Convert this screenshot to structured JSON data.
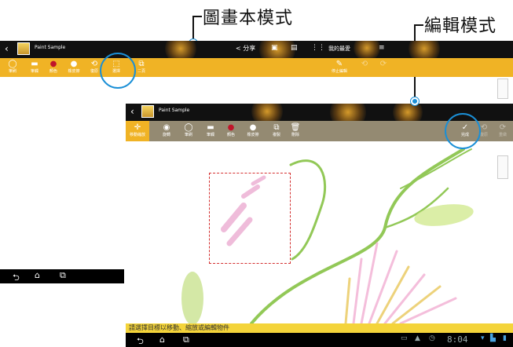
{
  "callouts": {
    "book_mode": "圖畫本模式",
    "edit_mode": "編輯模式"
  },
  "app": {
    "title": "Paint Sample"
  },
  "book_actionbar": {
    "share_label": "分享",
    "favorite_label": "我的最愛",
    "menu_icon": "overflow-menu-icon"
  },
  "book_toolbar": {
    "items": [
      {
        "label": "筆刷",
        "icon": "brush-icon"
      },
      {
        "label": "筆觸",
        "icon": "stroke-icon"
      },
      {
        "label": "顏色",
        "icon": "color-icon"
      },
      {
        "label": "橡皮擦",
        "icon": "eraser-icon"
      },
      {
        "label": "復原",
        "icon": "undo-icon"
      },
      {
        "label": "選擇",
        "icon": "select-icon"
      },
      {
        "label": "二頁",
        "icon": "two-page-icon"
      }
    ],
    "stop_edit": "停止編輯"
  },
  "edit_toolbar": {
    "items": [
      {
        "label": "移動縮放",
        "icon": "move-scale-icon"
      },
      {
        "label": "旋轉",
        "icon": "rotate-icon"
      },
      {
        "label": "筆刷",
        "icon": "brush-icon"
      },
      {
        "label": "筆觸",
        "icon": "stroke-icon"
      },
      {
        "label": "顏色",
        "icon": "color-icon"
      },
      {
        "label": "橡皮擦",
        "icon": "eraser-icon"
      },
      {
        "label": "複製",
        "icon": "copy-icon"
      },
      {
        "label": "刪除",
        "icon": "delete-icon"
      }
    ],
    "done": "完成",
    "undo": "復原",
    "redo": "重做"
  },
  "status_message": "請選擇目標以移動、縮放或編輯物件",
  "system_bar": {
    "time": "8:04"
  },
  "colors": {
    "toolbar_yellow": "#f0b325",
    "edit_toolbar": "#948a72",
    "highlight_circle": "#1a8fd6",
    "selection_border": "#d43030"
  }
}
